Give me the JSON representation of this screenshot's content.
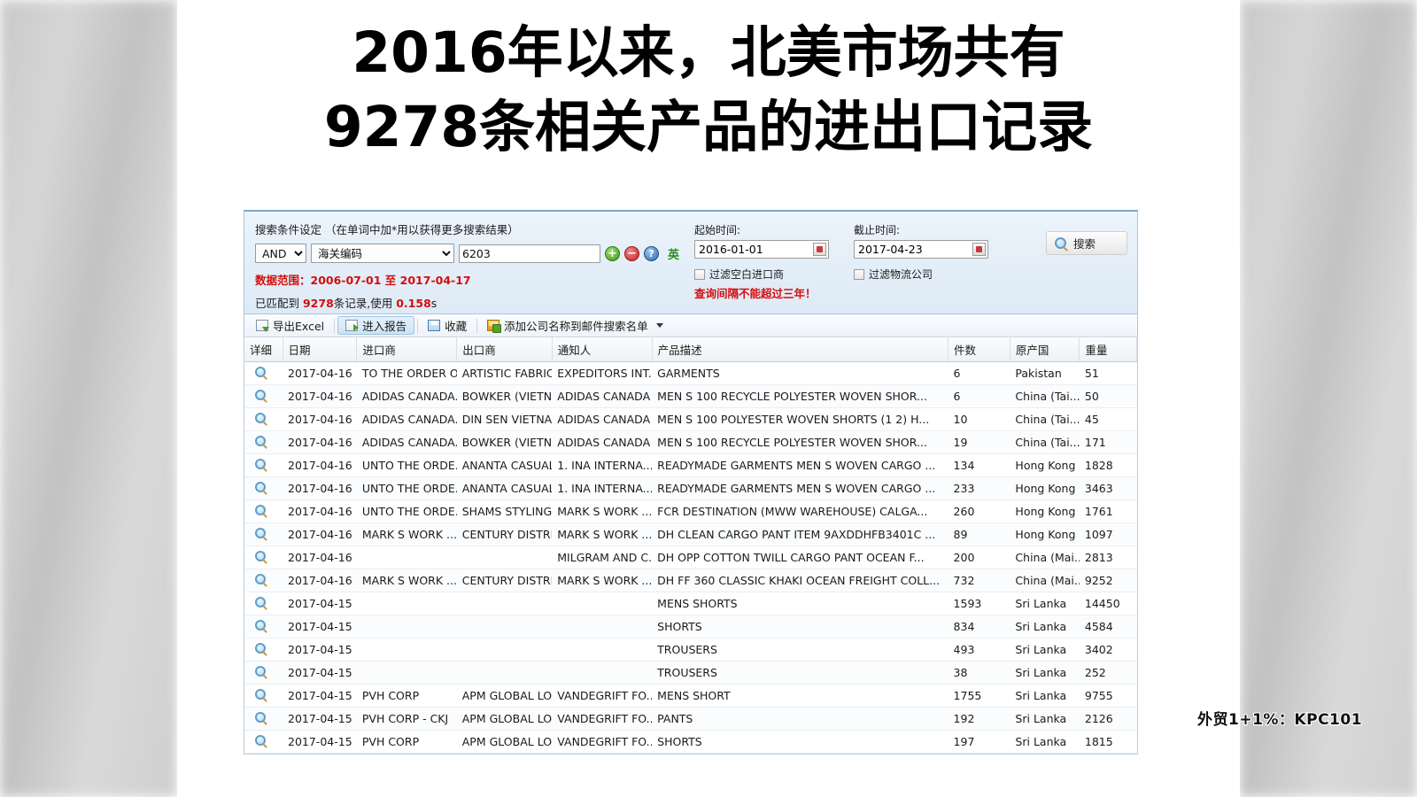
{
  "title": {
    "line1": "2016年以来，北美市场共有",
    "line2": "9278条相关产品的进出口记录"
  },
  "search_panel": {
    "condition_title": "搜索条件设定 （在单词中加*用以获得更多搜索结果）",
    "operator_value": "AND",
    "field_value": "海关编码",
    "keyword_value": "6203",
    "add_icon": "plus-circle-icon",
    "remove_icon": "minus-circle-icon",
    "help_icon": "help-circle-icon",
    "lang_toggle": "英",
    "data_range_line": "数据范围：2006-07-01 至 2017-04-17",
    "match_prefix": "已匹配到 ",
    "match_count": "9278",
    "match_middle": "条记录,使用 ",
    "match_time": "0.158",
    "match_suffix": "s",
    "start_label": "起始时间:",
    "start_value": "2016-01-01",
    "end_label": "截止时间:",
    "end_value": "2017-04-23",
    "filter_blank_importer": "过滤空白进口商",
    "filter_logistics": "过滤物流公司",
    "interval_warning": "查询间隔不能超过三年！",
    "search_button": "搜索",
    "accent_red": "#d30d0d",
    "panel_bg": "#e6f0f9"
  },
  "toolbar": {
    "export_excel": "导出Excel",
    "enter_report": "进入报告",
    "favorite": "收藏",
    "add_company_to_mail_list": "添加公司名称到邮件搜索名单"
  },
  "table": {
    "columns": [
      "详细",
      "日期",
      "进口商",
      "出口商",
      "通知人",
      "产品描述",
      "件数",
      "原产国",
      "重量"
    ],
    "rows": [
      {
        "date": "2017-04-16",
        "importer": "TO THE ORDER OF",
        "exporter": "ARTISTIC FABRIC...",
        "notify": "EXPEDITORS INT...",
        "desc": "GARMENTS",
        "qty": "6",
        "origin": "Pakistan",
        "weight": "51"
      },
      {
        "date": "2017-04-16",
        "importer": "ADIDAS CANADA...",
        "exporter": "BOWKER (VIETN...",
        "notify": "ADIDAS CANADA",
        "desc": "MEN S 100 RECYCLE POLYESTER WOVEN SHOR...",
        "qty": "6",
        "origin": "China (Tai...",
        "weight": "50"
      },
      {
        "date": "2017-04-16",
        "importer": "ADIDAS CANADA...",
        "exporter": "DIN SEN VIETNA...",
        "notify": "ADIDAS CANADA",
        "desc": "MEN S 100 POLYESTER WOVEN SHORTS (1 2) H...",
        "qty": "10",
        "origin": "China (Tai...",
        "weight": "45"
      },
      {
        "date": "2017-04-16",
        "importer": "ADIDAS CANADA...",
        "exporter": "BOWKER (VIETN...",
        "notify": "ADIDAS CANADA",
        "desc": "MEN S 100 RECYCLE POLYESTER WOVEN SHOR...",
        "qty": "19",
        "origin": "China (Tai...",
        "weight": "171"
      },
      {
        "date": "2017-04-16",
        "importer": "UNTO THE ORDE...",
        "exporter": "ANANTA CASUAL...",
        "notify": "1. INA INTERNA...",
        "desc": "READYMADE GARMENTS MEN S WOVEN CARGO ...",
        "qty": "134",
        "origin": "Hong Kong",
        "weight": "1828"
      },
      {
        "date": "2017-04-16",
        "importer": "UNTO THE ORDE...",
        "exporter": "ANANTA CASUAL...",
        "notify": "1. INA INTERNA...",
        "desc": "READYMADE GARMENTS MEN S WOVEN CARGO ...",
        "qty": "233",
        "origin": "Hong Kong",
        "weight": "3463"
      },
      {
        "date": "2017-04-16",
        "importer": "UNTO THE ORDE...",
        "exporter": "SHAMS STYLING ...",
        "notify": "MARK S WORK ...",
        "desc": "FCR DESTINATION (MWW WAREHOUSE) CALGA...",
        "qty": "260",
        "origin": "Hong Kong",
        "weight": "1761"
      },
      {
        "date": "2017-04-16",
        "importer": "MARK S WORK ...",
        "exporter": "CENTURY DISTRI...",
        "notify": "MARK S WORK ...",
        "desc": "DH CLEAN CARGO PANT ITEM 9AXDDHFB3401C ...",
        "qty": "89",
        "origin": "Hong Kong",
        "weight": "1097"
      },
      {
        "date": "2017-04-16",
        "importer": "",
        "exporter": "",
        "notify": "MILGRAM AND C...",
        "desc": "DH OPP COTTON TWILL CARGO PANT OCEAN F...",
        "qty": "200",
        "origin": "China (Mai...",
        "weight": "2813"
      },
      {
        "date": "2017-04-16",
        "importer": "MARK S WORK ...",
        "exporter": "CENTURY DISTRI...",
        "notify": "MARK S WORK ...",
        "desc": "DH FF 360 CLASSIC KHAKI OCEAN FREIGHT COLL...",
        "qty": "732",
        "origin": "China (Mai...",
        "weight": "9252"
      },
      {
        "date": "2017-04-15",
        "importer": "",
        "exporter": "",
        "notify": "",
        "desc": "MENS SHORTS",
        "qty": "1593",
        "origin": "Sri Lanka",
        "weight": "14450"
      },
      {
        "date": "2017-04-15",
        "importer": "",
        "exporter": "",
        "notify": "",
        "desc": "SHORTS",
        "qty": "834",
        "origin": "Sri Lanka",
        "weight": "4584"
      },
      {
        "date": "2017-04-15",
        "importer": "",
        "exporter": "",
        "notify": "",
        "desc": "TROUSERS",
        "qty": "493",
        "origin": "Sri Lanka",
        "weight": "3402"
      },
      {
        "date": "2017-04-15",
        "importer": "",
        "exporter": "",
        "notify": "",
        "desc": "TROUSERS",
        "qty": "38",
        "origin": "Sri Lanka",
        "weight": "252"
      },
      {
        "date": "2017-04-15",
        "importer": "PVH CORP",
        "exporter": "APM GLOBAL LO...",
        "notify": "VANDEGRIFT FO...",
        "desc": "MENS SHORT",
        "qty": "1755",
        "origin": "Sri Lanka",
        "weight": "9755"
      },
      {
        "date": "2017-04-15",
        "importer": "PVH CORP - CKJ",
        "exporter": "APM GLOBAL LO...",
        "notify": "VANDEGRIFT FO...",
        "desc": "PANTS",
        "qty": "192",
        "origin": "Sri Lanka",
        "weight": "2126"
      },
      {
        "date": "2017-04-15",
        "importer": "PVH CORP",
        "exporter": "APM GLOBAL LO...",
        "notify": "VANDEGRIFT FO...",
        "desc": "SHORTS",
        "qty": "197",
        "origin": "Sri Lanka",
        "weight": "1815"
      }
    ]
  },
  "watermark": "外贸1+1%：KPC101"
}
